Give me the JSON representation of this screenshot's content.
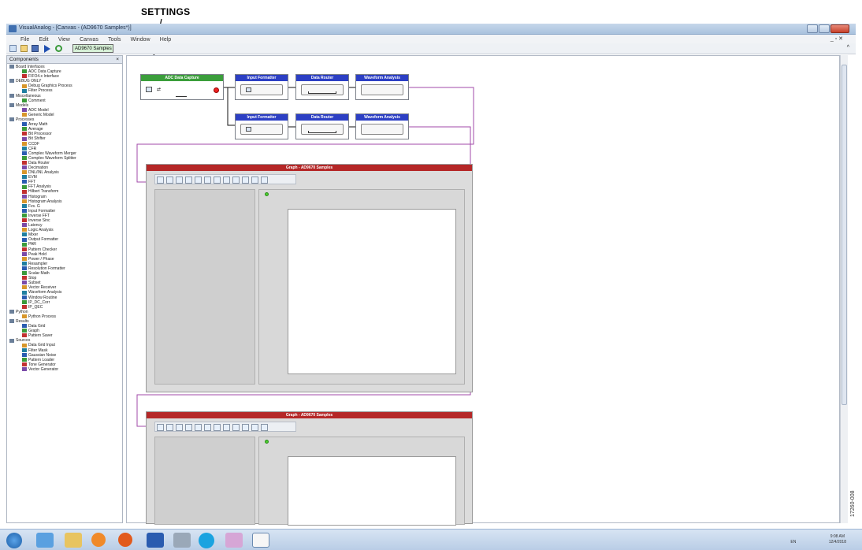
{
  "annotation": {
    "label": "SETTINGS"
  },
  "window": {
    "title": "VisualAnalog - [Canvas - (AD9670 Samples*)]"
  },
  "menu": [
    "File",
    "Edit",
    "View",
    "Canvas",
    "Tools",
    "Window",
    "Help"
  ],
  "toolbar": {
    "dataset": "AD9670 Samples"
  },
  "components": {
    "header": "Components",
    "items": [
      "Board Interfaces",
      "ADC Data Capture",
      "FIFO4.x Interface",
      "DEBUG ONLY",
      "Debug Graphics Process",
      "Filter Process",
      "Miscellaneous",
      "Comment",
      "Models",
      "ADC Model",
      "Generic Model",
      "Processes",
      "Array Math",
      "Average",
      "Bit Processor",
      "Bit Shifter",
      "CCDF",
      "CFR",
      "Complex Waveform Merger",
      "Complex Waveform Splitter",
      "Data Router",
      "Decimation",
      "DNL/INL Analysis",
      "EVM",
      "FFT",
      "FFT Analysis",
      "Hilbert Transform",
      "Histogram",
      "Histogram Analysis",
      "Fvs. G",
      "Input Formatter",
      "Inverse FFT",
      "Inverse Sinc",
      "Latency",
      "Logic Analysis",
      "Mixer",
      "Output Formatter",
      "PAR",
      "Pattern Checker",
      "Peak Hold",
      "Power / Phase",
      "Resampler",
      "Resolution Formatter",
      "Scalar Math",
      "Stop",
      "Subset",
      "Vector Receiver",
      "Waveform Analysis",
      "Window Routine",
      "IP_DC_Corr",
      "IP_QEC",
      "Python",
      "Python Process",
      "Results",
      "Data Grid",
      "Graph",
      "Pattern Saver",
      "Sources",
      "Data Grid Input",
      "Filter Mask",
      "Gaussian Noise",
      "Pattern Loader",
      "Tone Generator",
      "Vector Generator"
    ]
  },
  "canvas": {
    "adc_block": "ADC Data Capture",
    "input_formatter": "Input Formatter",
    "data_router": "Data Router",
    "waveform_analysis": "Waveform Analysis",
    "graph_title": "Graph - AD9670 Samples"
  },
  "tray": {
    "lang": "EN",
    "time": "9:08 AM",
    "date": "12/4/2018"
  },
  "figure_id": "17260-008"
}
